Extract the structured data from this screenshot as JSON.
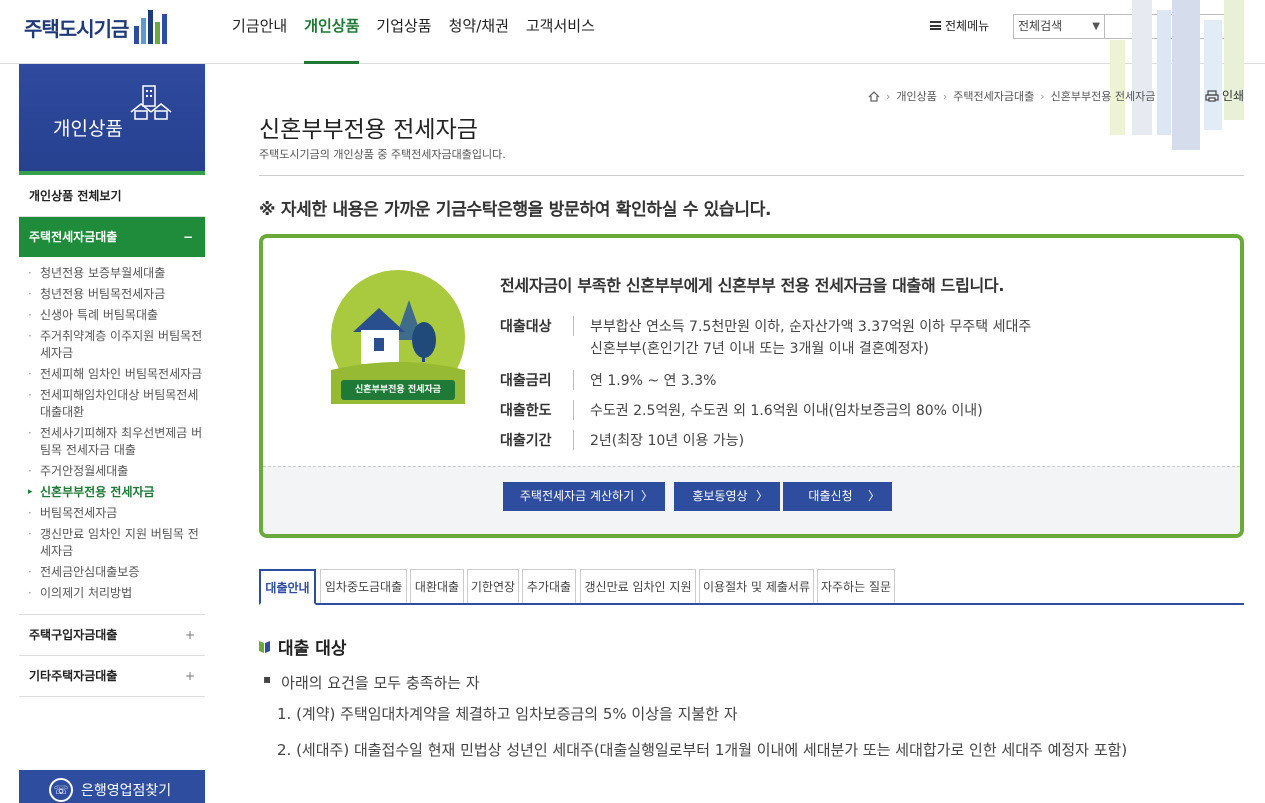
{
  "header": {
    "logo_text": "주택도시기금",
    "nav": [
      "기금안내",
      "개인상품",
      "기업상품",
      "청약/채권",
      "고객서비스"
    ],
    "active_nav_index": 1,
    "all_menu_label": "전체메뉴",
    "search_scope": "전체검색",
    "search_value": ""
  },
  "sidebar": {
    "banner_title": "개인상품",
    "overview_label": "개인상품 전체보기",
    "open_group": {
      "label": "주택전세자금대출",
      "sign": "−"
    },
    "sub_items": [
      "청년전용 보증부월세대출",
      "청년전용 버팀목전세자금",
      "신생아 특례 버팀목대출",
      "주거취약계층 이주지원 버팀목전세자금",
      "전세피해 임차인 버팀목전세자금",
      "전세피해임차인대상 버팀목전세대출대환",
      "전세사기피해자 최우선변제금 버팀목 전세자금 대출",
      "주거안정월세대출",
      "신혼부부전용 전세자금",
      "버팀목전세자금",
      "갱신만료 임차인 지원 버팀목 전세자금",
      "전세금안심대출보증",
      "이의제기 처리방법"
    ],
    "active_sub_index": 8,
    "closed_groups": [
      {
        "label": "주택구입자금대출",
        "sign": "+"
      },
      {
        "label": "기타주택자금대출",
        "sign": "+"
      }
    ],
    "branch_button": "은행영업점찾기"
  },
  "breadcrumb": [
    "개인상품",
    "주택전세자금대출",
    "신혼부부전용 전세자금"
  ],
  "print_label": "인쇄",
  "page": {
    "title": "신혼부부전용 전세자금",
    "description": "주택도시기금의 개인상품 중 주택전세자금대출입니다.",
    "notice": "※ 자세한 내용은 가까운 기금수탁은행을 방문하여 확인하실 수 있습니다."
  },
  "info": {
    "badge": "신혼부부전용 전세자금",
    "headline": "전세자금이 부족한 신혼부부에게 신혼부부 전용 전세자금을 대출해 드립니다.",
    "rows": [
      {
        "label": "대출대상",
        "lines": [
          "부부합산 연소득 7.5천만원 이하, 순자산가액 3.37억원 이하 무주택 세대주",
          "신혼부부(혼인기간 7년 이내 또는 3개월 이내 결혼예정자)"
        ]
      },
      {
        "label": "대출금리",
        "lines": [
          "연 1.9% ~ 연 3.3%"
        ]
      },
      {
        "label": "대출한도",
        "lines": [
          "수도권 2.5억원, 수도권 외 1.6억원 이내(임차보증금의 80% 이내)"
        ]
      },
      {
        "label": "대출기간",
        "lines": [
          "2년(최장 10년 이용 가능)"
        ]
      }
    ],
    "buttons": [
      "주택전세자금 계산하기",
      "홍보동영상",
      "대출신청"
    ]
  },
  "tabs": [
    "대출안내",
    "임차중도금대출",
    "대환대출",
    "기한연장",
    "추가대출",
    "갱신만료 임차인 지원",
    "이용절차 및 제출서류",
    "자주하는 질문"
  ],
  "active_tab_index": 0,
  "section": {
    "title": "대출 대상",
    "bullet": "아래의 요건을 모두 충족하는 자",
    "requirements": [
      "1. (계약) 주택임대차계약을 체결하고 임차보증금의 5% 이상을 지불한 자",
      "2. (세대주) 대출접수일 현재 민법상 성년인 세대주(대출실행일로부터 1개월 이내에 세대분가 또는 세대합가로 인한 세대주 예정자 포함)"
    ]
  },
  "colors": {
    "primary_blue": "#2e4d9f",
    "accent_green": "#1e7a36",
    "box_border_green": "#6aaa3a",
    "badge_green": "#a9c93e"
  }
}
